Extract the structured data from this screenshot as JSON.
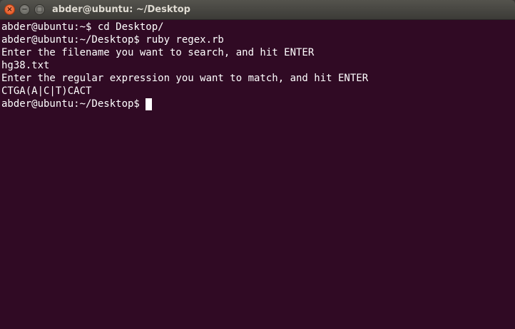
{
  "window": {
    "title": "abder@ubuntu: ~/Desktop",
    "close_glyph": "×",
    "minimize_glyph": "−",
    "maximize_glyph": "□"
  },
  "terminal": {
    "lines": [
      "abder@ubuntu:~$ cd Desktop/",
      "abder@ubuntu:~/Desktop$ ruby regex.rb",
      "Enter the filename you want to search, and hit ENTER",
      "hg38.txt",
      "Enter the regular expression you want to match, and hit ENTER",
      "CTGA(A|C|T)CACT"
    ],
    "prompt": "abder@ubuntu:~/Desktop$ ",
    "background_color": "#300a24",
    "text_color": "#ffffff"
  }
}
